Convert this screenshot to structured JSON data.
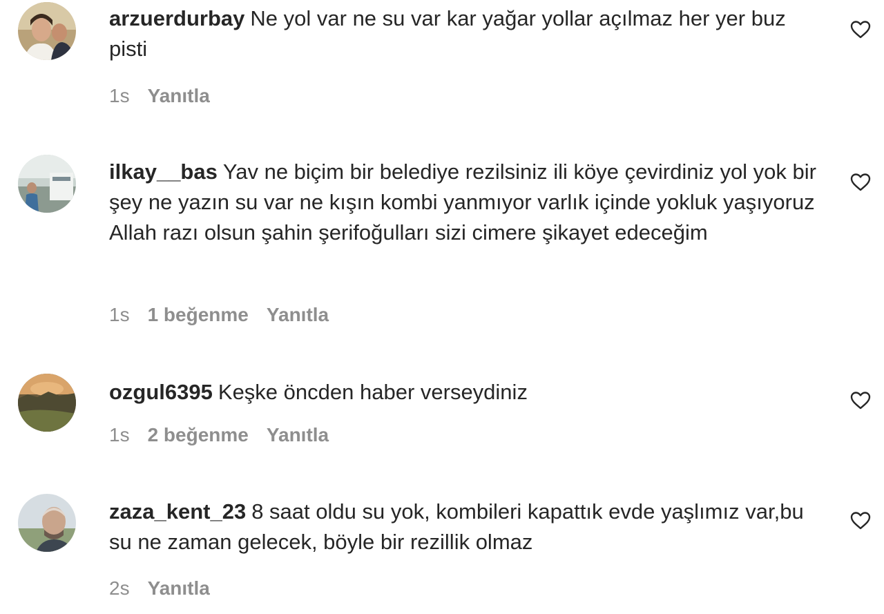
{
  "comments": [
    {
      "username": "arzuerdurbay",
      "text": "Ne yol var ne su var kar yağar yollar açılmaz her yer buz pisti",
      "time": "1s",
      "likes": "",
      "reply": "Yanıtla",
      "avatar_icon": "user-avatar-photo"
    },
    {
      "username": "ilkay__bas",
      "text": "Yav ne biçim bir belediye rezilsiniz ili köye çevirdiniz yol yok bir şey ne yazın su var ne kışın kombi yanmıyor varlık içinde yokluk yaşıyoruz Allah razı olsun şahin şerifoğulları sizi cimere şikayet edeceğim",
      "time": "1s",
      "likes": "1 beğenme",
      "reply": "Yanıtla",
      "avatar_icon": "user-avatar-photo"
    },
    {
      "username": "ozgul6395",
      "text": "Keşke öncden haber verseydiniz",
      "time": "1s",
      "likes": "2 beğenme",
      "reply": "Yanıtla",
      "avatar_icon": "user-avatar-photo"
    },
    {
      "username": "zaza_kent_23",
      "text": "8 saat oldu su yok, kombileri kapattık evde yaşlımız var,bu su ne zaman gelecek, böyle bir rezillik olmaz",
      "time": "2s",
      "likes": "",
      "reply": "Yanıtla",
      "avatar_icon": "user-avatar-photo"
    }
  ],
  "colors": {
    "text": "#262626",
    "meta": "#8e8e8e",
    "heart_stroke": "#262626"
  },
  "icons": {
    "like": "heart-outline-icon"
  }
}
